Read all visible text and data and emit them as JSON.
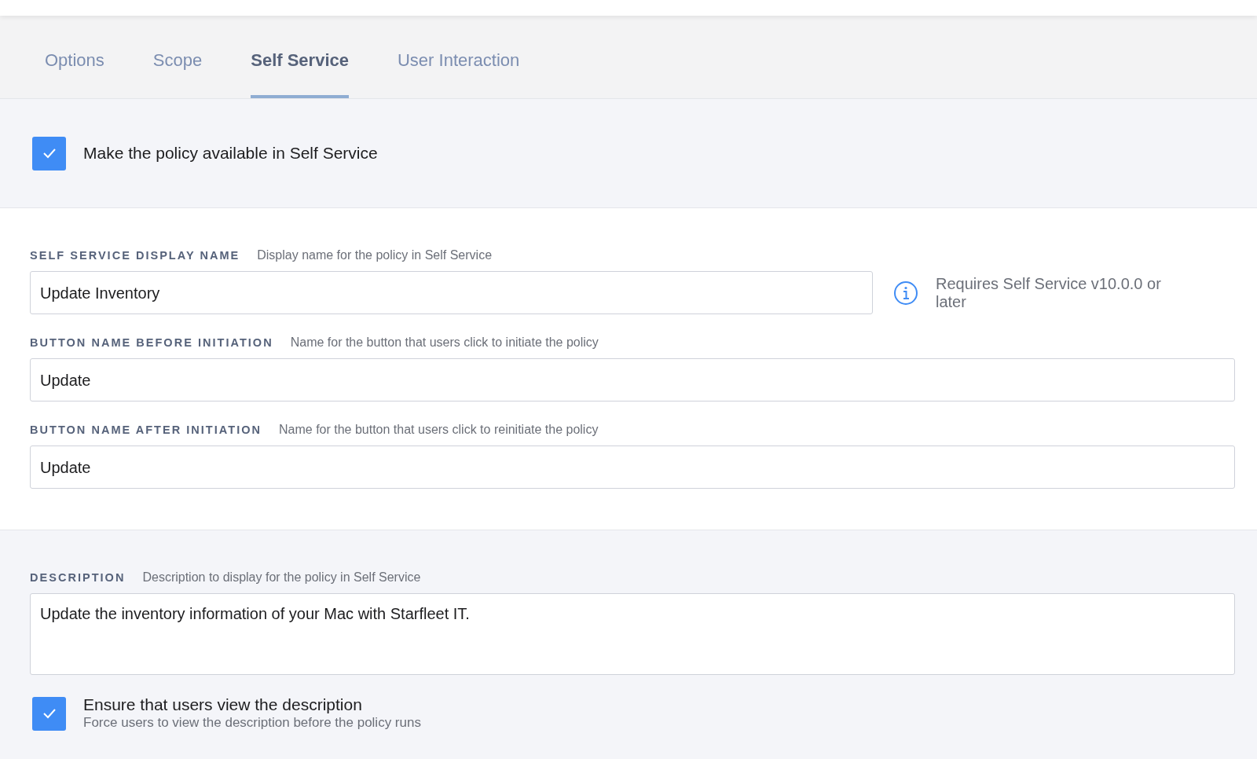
{
  "tabs": [
    {
      "label": "Options",
      "selected": false
    },
    {
      "label": "Scope",
      "selected": false
    },
    {
      "label": "Self Service",
      "selected": true
    },
    {
      "label": "User Interaction",
      "selected": false
    }
  ],
  "availability": {
    "label": "Make the policy available in Self Service",
    "checked": true
  },
  "fields": [
    {
      "label": "SELF SERVICE DISPLAY NAME",
      "hint": "Display name for the policy in Self Service",
      "value": "Update Inventory",
      "note": "Requires Self Service v10.0.0 or later"
    },
    {
      "label": "BUTTON NAME BEFORE INITIATION",
      "hint": "Name for the button that users click to initiate the policy",
      "value": "Update"
    },
    {
      "label": "BUTTON NAME AFTER INITIATION",
      "hint": "Name for the button that users click to reinitiate the policy",
      "value": "Update"
    }
  ],
  "description": {
    "label": "DESCRIPTION",
    "hint": "Description to display for the policy in Self Service",
    "value": "Update the inventory information of your Mac with Starfleet IT."
  },
  "ensure_view": {
    "label": "Ensure that users view the description",
    "sublabel": "Force users to view the description before the policy runs",
    "checked": true
  }
}
